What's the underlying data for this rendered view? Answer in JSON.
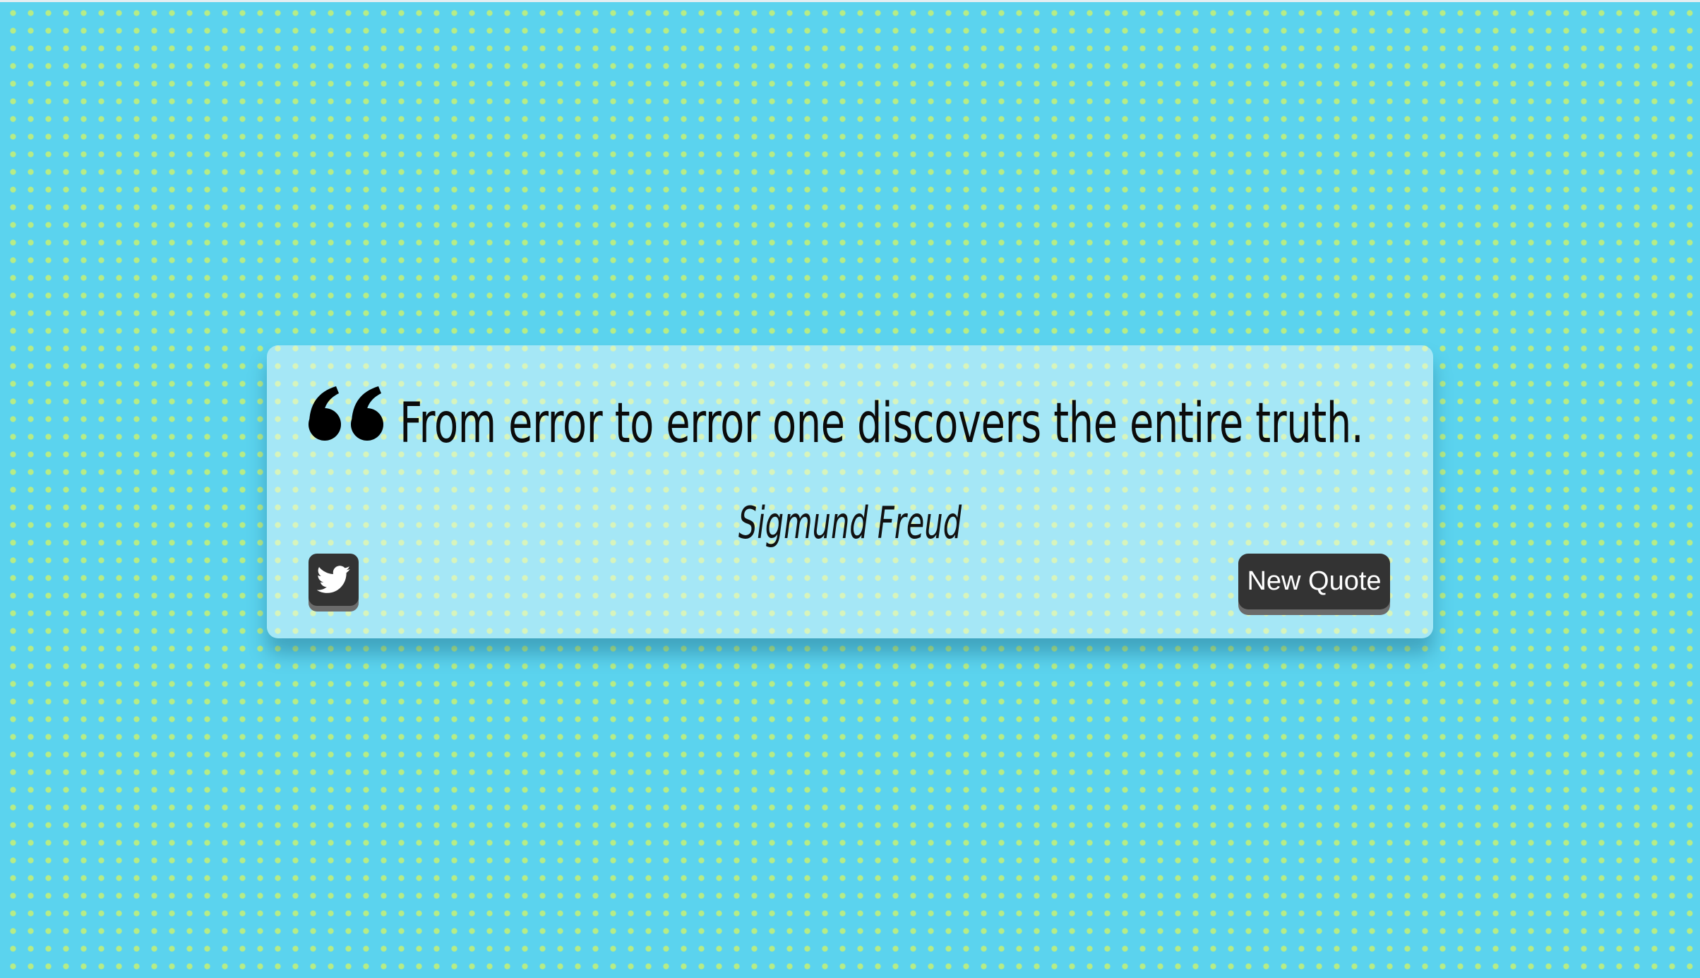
{
  "quote": {
    "text": "From error to error one discovers the entire truth.",
    "author": "Sigmund Freud"
  },
  "actions": {
    "new_quote_label": "New Quote",
    "tweet_icon": "twitter-icon"
  },
  "colors": {
    "background": "#5bd3ee",
    "dots": "#b6ec86",
    "button": "#333333",
    "button_text": "#ffffff",
    "text": "#0b0b0b"
  }
}
